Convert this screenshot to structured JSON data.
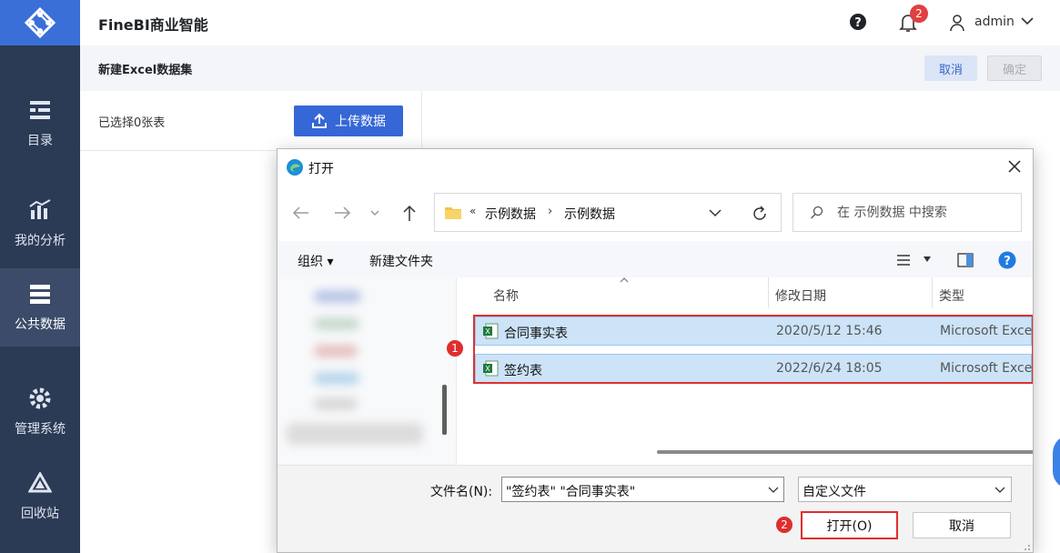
{
  "app": {
    "title": "FineBI商业智能"
  },
  "header": {
    "notifications": "2",
    "username": "admin"
  },
  "sidebar": {
    "items": [
      {
        "label": "目录",
        "icon": "catalog-icon"
      },
      {
        "label": "我的分析",
        "icon": "analysis-icon"
      },
      {
        "label": "公共数据",
        "icon": "public-data-icon",
        "active": true
      },
      {
        "label": "管理系统",
        "icon": "gear-icon"
      },
      {
        "label": "回收站",
        "icon": "recycle-icon"
      }
    ]
  },
  "subheader": {
    "title": "新建Excel数据集",
    "cancel": "取消",
    "confirm": "确定"
  },
  "panel": {
    "selected": "已选择0张表",
    "upload": "上传数据"
  },
  "dialog": {
    "title": "打开",
    "breadcrumb": {
      "chevron": "«",
      "parent": "示例数据",
      "sep": "›",
      "current": "示例数据"
    },
    "search_placeholder": "在 示例数据 中搜索",
    "toolbar": {
      "organize": "组织 ▾",
      "new_folder": "新建文件夹"
    },
    "columns": {
      "name": "名称",
      "date": "修改日期",
      "type": "类型"
    },
    "files": [
      {
        "name": "合同事实表",
        "date": "2020/5/12 15:46",
        "type": "Microsoft Excel"
      },
      {
        "name": "签约表",
        "date": "2022/6/24 18:05",
        "type": "Microsoft Excel"
      }
    ],
    "filename_label": "文件名(N):",
    "filename_value": "\"签约表\" \"合同事实表\"",
    "filetype_value": "自定义文件",
    "open": "打开(O)",
    "cancel": "取消"
  },
  "steps": {
    "one": "1",
    "two": "2"
  },
  "colors": {
    "sidebar": "#2b3a55",
    "brand": "#3a6fd8",
    "selection": "#cce3f8",
    "highlight": "#e03030"
  }
}
